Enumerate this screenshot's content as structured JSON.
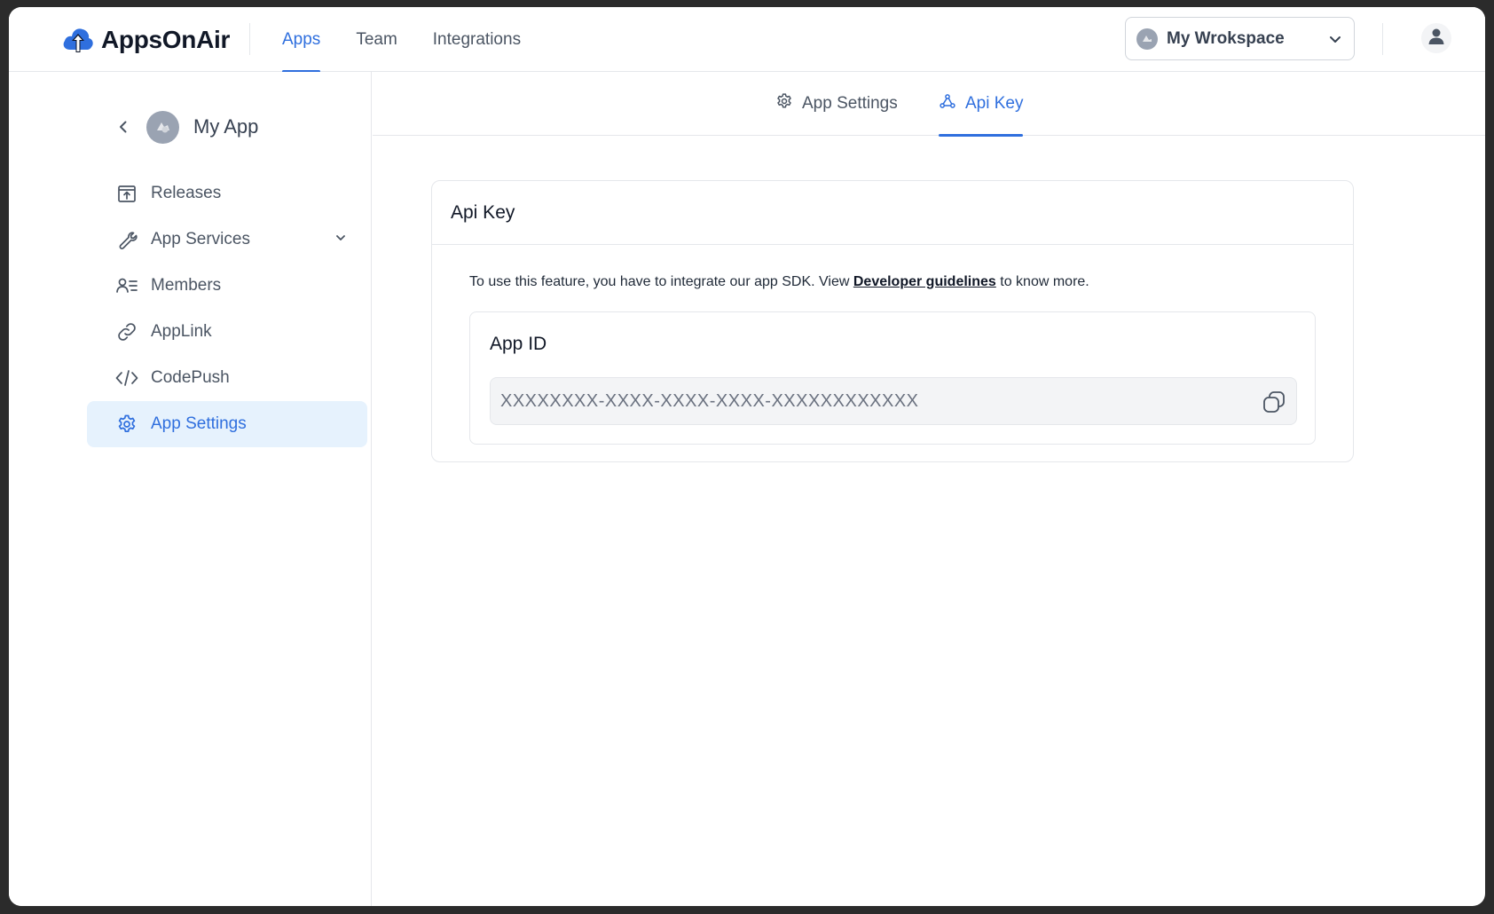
{
  "header": {
    "brand_name": "AppsOnAir",
    "nav": [
      {
        "label": "Apps",
        "active": true
      },
      {
        "label": "Team",
        "active": false
      },
      {
        "label": "Integrations",
        "active": false
      }
    ],
    "workspace_name": "My Wrokspace"
  },
  "sidebar": {
    "app_name": "My App",
    "items": [
      {
        "label": "Releases",
        "icon": "releases-icon"
      },
      {
        "label": "App Services",
        "icon": "wrench-icon"
      },
      {
        "label": "Members",
        "icon": "members-icon"
      },
      {
        "label": "AppLink",
        "icon": "link-icon"
      },
      {
        "label": "CodePush",
        "icon": "code-icon"
      },
      {
        "label": "App Settings",
        "icon": "gear-icon",
        "active": true
      }
    ]
  },
  "main": {
    "tabs": [
      {
        "label": "App Settings",
        "icon": "gear-icon"
      },
      {
        "label": "Api Key",
        "icon": "webhook-icon",
        "active": true
      }
    ],
    "card": {
      "title": "Api Key",
      "info_prefix": "To use this feature, you have to integrate our app SDK. View",
      "info_link": "Developer guidelines",
      "info_suffix": "to know more.",
      "field_label": "App ID",
      "field_value": "XXXXXXXX-XXXX-XXXX-XXXX-XXXXXXXXXXXX"
    }
  },
  "colors": {
    "accent": "#2f6fde",
    "active_bg": "#e6f2fd",
    "text": "#4b5563",
    "border": "#e5e7eb"
  }
}
